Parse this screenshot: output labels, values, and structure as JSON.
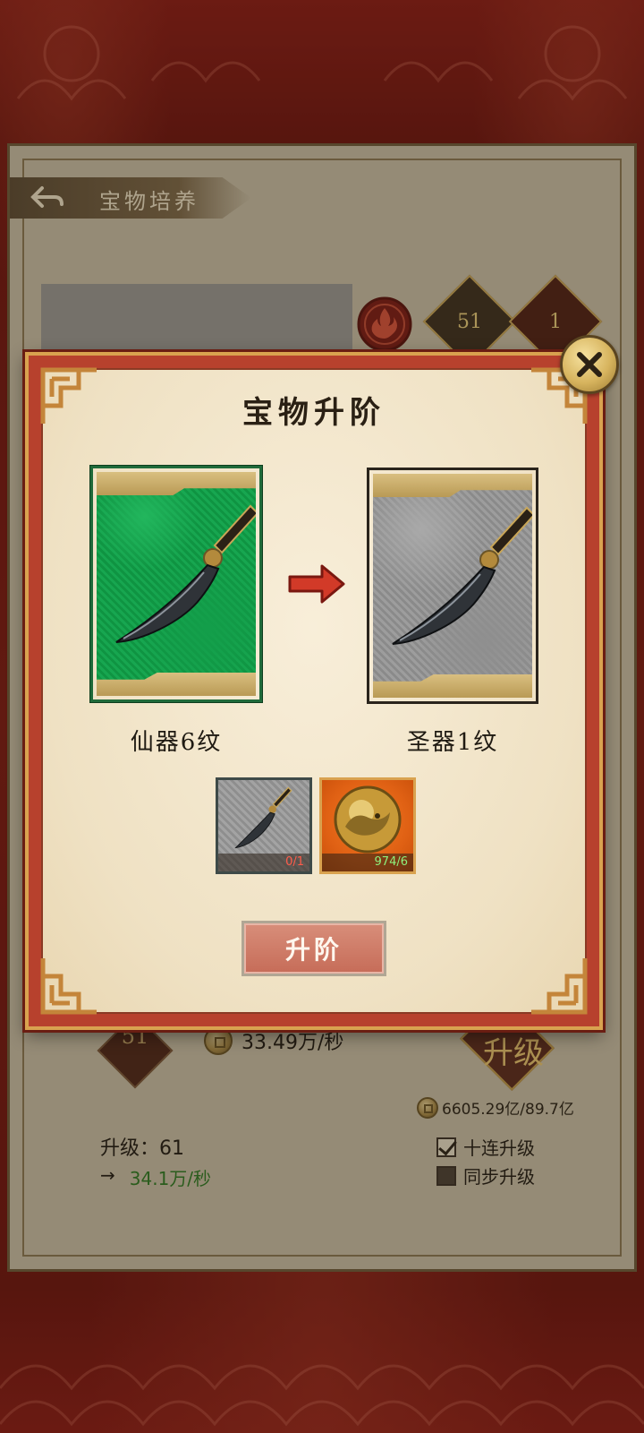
{
  "screen": {
    "title": "宝物培养",
    "header_badges": [
      "51",
      "1"
    ]
  },
  "modal": {
    "title": "宝物升阶",
    "current_item": {
      "label": "仙器6纹",
      "rarity_color": "#17a650"
    },
    "next_item": {
      "label": "圣器1纹",
      "rarity_color": "#9a9a9a"
    },
    "materials": [
      {
        "name": "blade-material",
        "count": "0/1",
        "enough": false
      },
      {
        "name": "gold-dragon-orb",
        "count": "974/6",
        "enough": true
      }
    ],
    "action_button": "升阶"
  },
  "base": {
    "level_badge": "51",
    "rate": "33.49万/秒",
    "upgrade_button": "升级",
    "gold": "6605.29亿/89.7亿",
    "level_text": "升级：61",
    "next_arrow": "→",
    "next_rate": "34.1万/秒",
    "options": [
      {
        "label": "十连升级",
        "checked": true
      },
      {
        "label": "同步升级",
        "checked": false
      }
    ]
  },
  "colors": {
    "accent_red": "#b7412d",
    "gold": "#d9a24f",
    "parchment": "#f3e7cd"
  }
}
